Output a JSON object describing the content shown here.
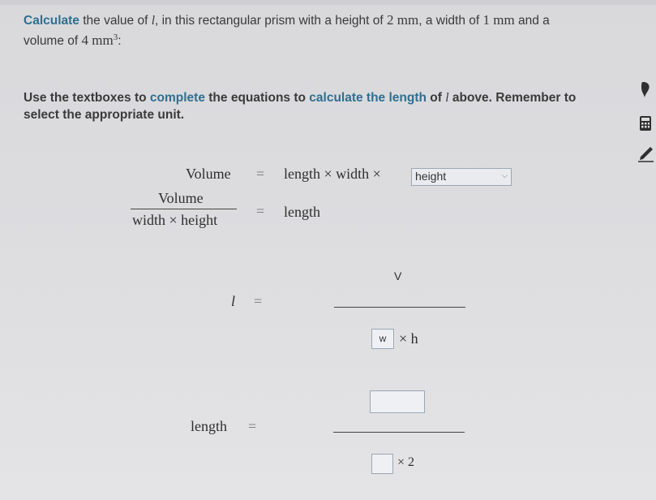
{
  "question": {
    "part1": "Calculate",
    "part2": " the value of ",
    "var_l": "l",
    "part3": ", in this rectangular prism with a height of ",
    "height_value": "2 mm",
    "part4": ", a width of ",
    "width_value": "1 mm",
    "part5": " and a",
    "part6": "volume of ",
    "volume_value": "4 mm",
    "volume_exp": "3",
    "part7": ":"
  },
  "instruction": {
    "part1": "Use the textboxes to ",
    "complete": "complete",
    "part2": " the equations to ",
    "calculate": "calculate the length",
    "part3": " of ",
    "var_l": "l",
    "part4": " above. Remember to",
    "line2": "select the appropriate unit."
  },
  "eq1": {
    "lhs": "Volume",
    "equals": "=",
    "rhs": "length × width ×",
    "select_value": "height"
  },
  "eq2": {
    "numerator": "Volume",
    "denominator": "width × height",
    "equals": "=",
    "rhs": "length"
  },
  "eq3": {
    "lhs": "l",
    "equals": "=",
    "numerator": "V",
    "denominator_input": "w",
    "denominator_rest": "× h"
  },
  "eq4": {
    "lhs": "length",
    "equals": "=",
    "numerator_input": "",
    "denominator_input": "",
    "denominator_rest": "× 2"
  },
  "colors": {
    "highlight": "#2f6f8f",
    "text": "#3a3a3a"
  },
  "icons": [
    "hint-icon",
    "calculator-icon",
    "pencil-icon"
  ]
}
